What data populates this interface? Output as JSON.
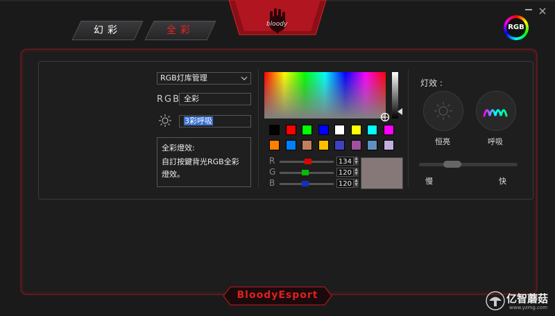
{
  "tabs": [
    {
      "label": "幻彩",
      "active": false
    },
    {
      "label": "全彩",
      "active": true
    }
  ],
  "logo_text": "bloody",
  "rgb_badge": "RGB",
  "preset_select": {
    "value": "RGB灯库管理"
  },
  "rgb_label": "RGB",
  "rgb_value": "全彩",
  "effect_value": "3彩呼吸",
  "description": {
    "title": "全彩燈效:",
    "body": "自訂按鍵背光RGB全彩燈效。"
  },
  "swatches_row1": [
    "#000000",
    "#ff0000",
    "#00ff00",
    "#0000ff",
    "#ffffff",
    "#ffff00",
    "#00ffff",
    "#ff00ff"
  ],
  "swatches_row2": [
    "#ff8000",
    "#0080ff",
    "#c08060",
    "#ffc000",
    "#4040c0",
    "#a050a0",
    "#6090c0",
    "#c0b0e0"
  ],
  "channels": [
    {
      "label": "R",
      "value": "134",
      "color": "#e00000",
      "fraction": 0.525
    },
    {
      "label": "G",
      "value": "120",
      "color": "#00c000",
      "fraction": 0.47
    },
    {
      "label": "B",
      "value": "120",
      "color": "#1030c0",
      "fraction": 0.47
    }
  ],
  "preview_color": "#867878",
  "brightness_slider_fraction": 0.85,
  "light_effect": {
    "title": "灯效 :",
    "options": [
      {
        "label": "恒亮",
        "icon": "sun-icon"
      },
      {
        "label": "呼吸",
        "icon": "wave-icon"
      }
    ],
    "speed_slow": "慢",
    "speed_fast": "快",
    "speed_fraction": 0.3
  },
  "mouse_led_colors": {
    "red": "#d01020",
    "green": "#10c040",
    "blue": "#1830d0"
  },
  "footer_brand": "BloodyEsport",
  "watermark": {
    "text": "亿智蘑菇",
    "sub": "www.yzmg.com"
  }
}
